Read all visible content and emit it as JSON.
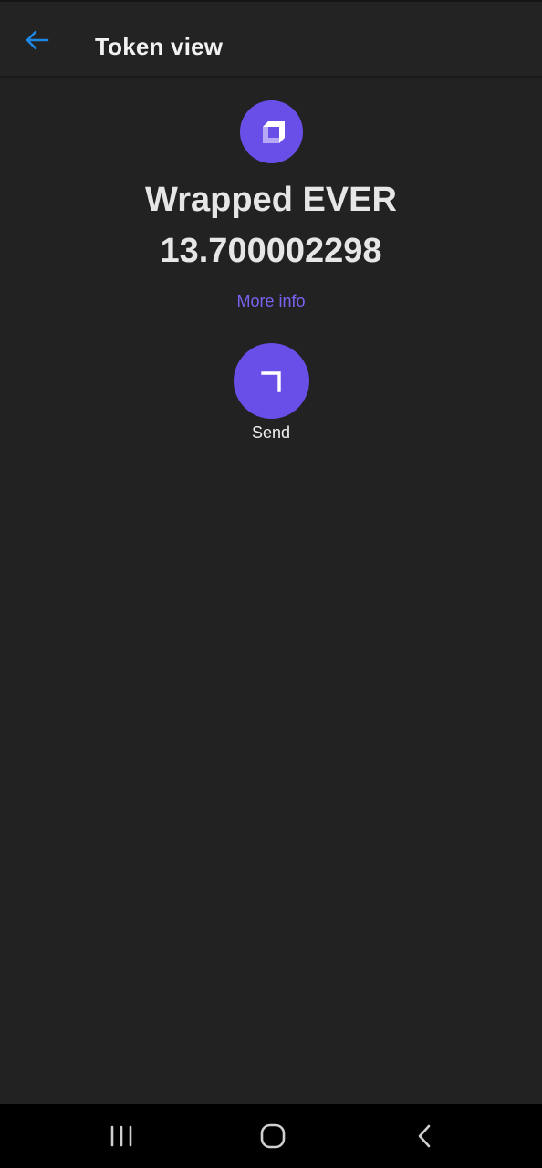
{
  "app_bar": {
    "title": "Token view",
    "back_icon": "arrow-left-icon",
    "accent": "#1e88e5"
  },
  "token": {
    "name": "Wrapped EVER",
    "balance": "13.700002298",
    "icon": "wrapped-ever-logo",
    "brand_color": "#6a4ee8"
  },
  "more_info_label": "More info",
  "send": {
    "label": "Send",
    "icon": "send-arrow-icon"
  },
  "system_nav": {
    "recents_icon": "recents-icon",
    "home_icon": "home-icon",
    "back_icon": "back-chevron-icon"
  }
}
